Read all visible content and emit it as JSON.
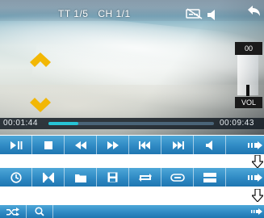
{
  "header": {
    "title": "TT 1/5",
    "chapter": "CH 1/1"
  },
  "volume": {
    "value": "00",
    "label": "VOL"
  },
  "playback": {
    "elapsed": "00:01:44",
    "total": "00:09:43",
    "progress": 0.179
  },
  "icons": {
    "top": [
      "subtitle-off-icon",
      "speaker-icon",
      "back-arrow-icon"
    ],
    "row1": [
      "play-pause-icon",
      "stop-icon",
      "rewind-icon",
      "fast-forward-icon",
      "previous-icon",
      "next-icon",
      "speaker-icon",
      "expand-arrow-icon"
    ],
    "row2": [
      "clock-icon",
      "bowtie-icon",
      "folder-icon",
      "save-icon",
      "repeat-icon",
      "link-icon",
      "ratio-icon",
      "expand-arrow-icon"
    ],
    "row3": [
      "shuffle-icon",
      "search-icon",
      "expand-arrow-icon"
    ]
  },
  "colors": {
    "button_bar": "#2f8ac4",
    "progress_fill": "#27c4d6",
    "arrow_accent": "#f2b705"
  }
}
